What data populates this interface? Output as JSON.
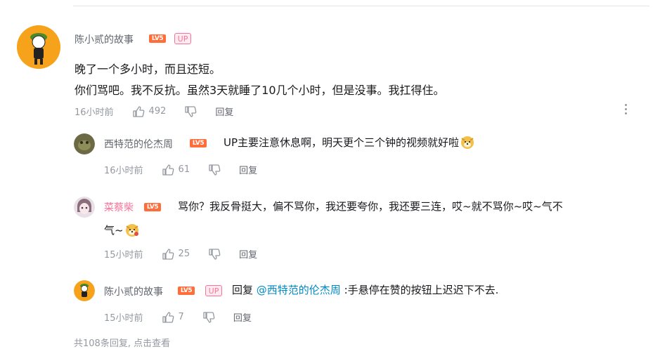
{
  "main_comment": {
    "username": "陈小贰的故事",
    "level_badge": "LV5",
    "up_badge": "UP",
    "text_line1": "晚了一个多小时，而且还短。",
    "text_line2": "你们骂吧。我不反抗。虽然3天就睡了10几个小时，但是没事。我扛得住。",
    "time": "16小时前",
    "likes": "492",
    "reply_label": "回复"
  },
  "replies": [
    {
      "username": "西特范的伦杰周",
      "level_badge": "LV5",
      "text": "UP主要注意休息啊，明天更个三个钟的视频就好啦",
      "time": "16小时前",
      "likes": "61",
      "reply_label": "回复"
    },
    {
      "username": "菜蔡柴",
      "level_badge": "LV5",
      "text_line1": "骂你？我反骨挺大，偏不骂你，我还要夸你，我还要三连，哎~就不骂你~哎~气不",
      "text_line2": "气~",
      "time": "15小时前",
      "likes": "25",
      "reply_label": "回复"
    },
    {
      "username": "陈小贰的故事",
      "level_badge": "LV5",
      "up_badge": "UP",
      "reply_prefix": "回复 ",
      "mention": "@西特范的伦杰周",
      "text": " :手悬停在赞的按钮上迟迟下不去.",
      "time": "15小时前",
      "likes": "7",
      "reply_label": "回复"
    }
  ],
  "summary": {
    "count_text": "共108条回复, ",
    "view_link": "点击查看"
  },
  "colors": {
    "username_gray": "#61666d",
    "username_pink": "#fb7299",
    "mention_blue": "#008ac5",
    "level_orange": "#ff6d3a",
    "meta_gray": "#9499a0"
  },
  "icons": [
    "thumbs-up-icon",
    "thumbs-down-icon",
    "more-vertical-icon",
    "doge-emoji-icon"
  ]
}
